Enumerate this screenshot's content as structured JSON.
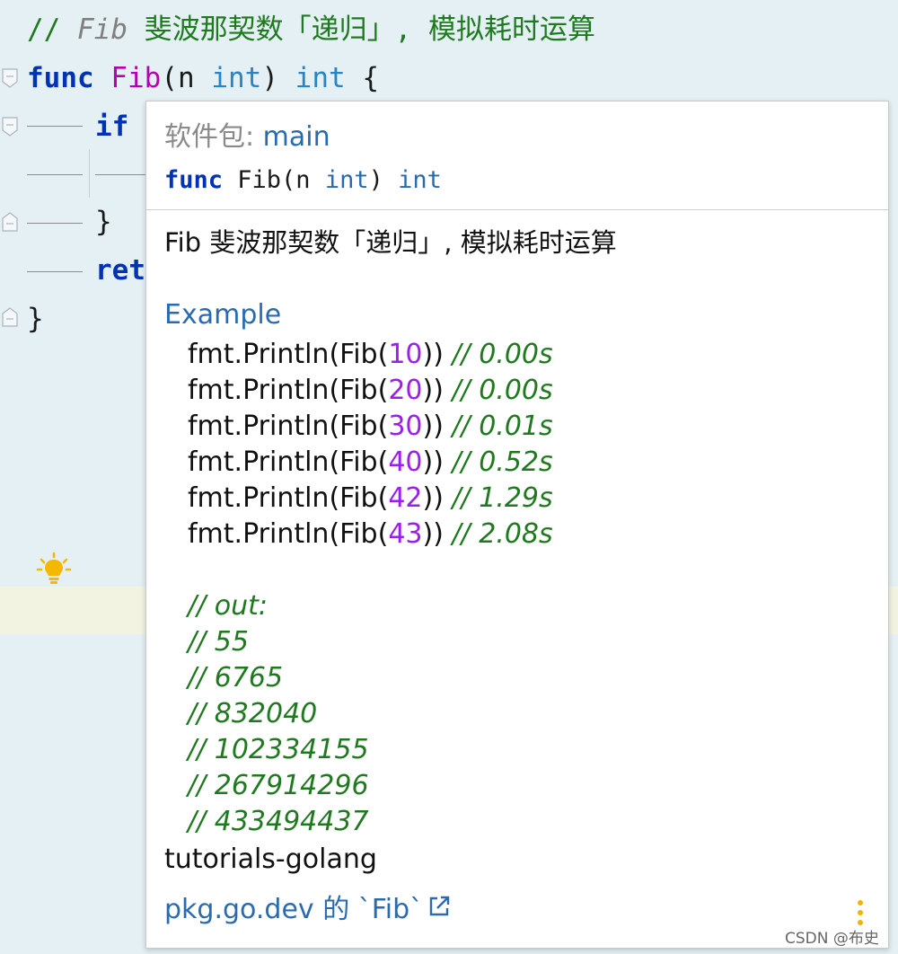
{
  "editor": {
    "line1": {
      "prefix": "// ",
      "name": "Fib",
      "rest": " 斐波那契数「递归」, 模拟耗时运算"
    },
    "line2": {
      "kw": "func",
      "fn": "Fib",
      "open": "(n ",
      "ptype": "int",
      "close": ") ",
      "rtype": "int",
      "brace": " {"
    },
    "line3": {
      "kw": "if"
    },
    "line5": {
      "brace": "}"
    },
    "line6": {
      "kw": "ret"
    },
    "line7": {
      "brace": "}"
    }
  },
  "popup": {
    "package_label": "软件包: ",
    "package_name": "main",
    "signature": {
      "kw": "func",
      "name": " Fib(n ",
      "ptype": "int",
      "mid": ") ",
      "rtype": "int"
    },
    "description": "Fib 斐波那契数「递归」, 模拟耗时运算",
    "example_title": "Example",
    "examples": [
      {
        "pre": "fmt.Println(Fib(",
        "num": "10",
        "post": ")) ",
        "comment": "// 0.00s"
      },
      {
        "pre": "fmt.Println(Fib(",
        "num": "20",
        "post": ")) ",
        "comment": "// 0.00s"
      },
      {
        "pre": "fmt.Println(Fib(",
        "num": "30",
        "post": ")) ",
        "comment": "// 0.01s"
      },
      {
        "pre": "fmt.Println(Fib(",
        "num": "40",
        "post": ")) ",
        "comment": "// 0.52s"
      },
      {
        "pre": "fmt.Println(Fib(",
        "num": "42",
        "post": ")) ",
        "comment": "// 1.29s"
      },
      {
        "pre": "fmt.Println(Fib(",
        "num": "43",
        "post": ")) ",
        "comment": "// 2.08s"
      }
    ],
    "output_comments": [
      "// out:",
      "// 55",
      "// 6765",
      "// 832040",
      "// 102334155",
      "// 267914296",
      "// 433494437"
    ],
    "repo_name": "tutorials-golang",
    "link_text": "pkg.go.dev 的 `Fib`"
  },
  "watermark": "CSDN @布史"
}
